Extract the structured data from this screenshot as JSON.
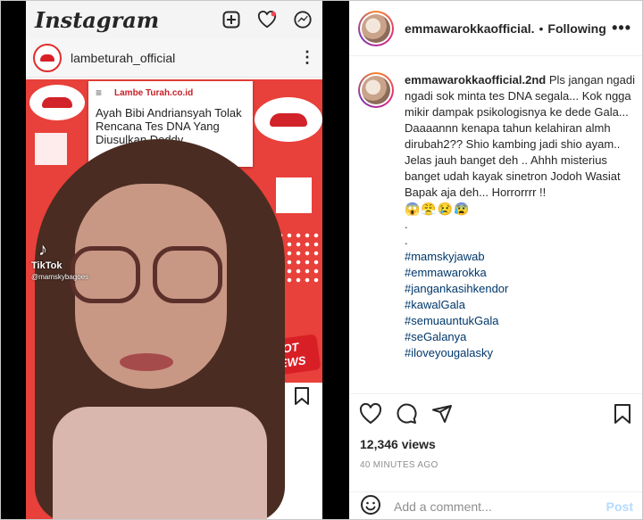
{
  "phone": {
    "app_logo": "Instagram",
    "account_name": "lambeturah_official",
    "card_site": "Lambe Turah.co.id",
    "card_headline": "Ayah Bibi Andriansyah Tolak Rencana Tes DNA Yang Diusulkan Doddy",
    "hot_news": "HOT NEWS",
    "tiktok_label": "TikTok",
    "tiktok_user": "@mamskybagoes"
  },
  "post_header": {
    "username": "emmawarokkaofficial.",
    "separator": "•",
    "follow_state": "Following",
    "more": "•••"
  },
  "caption": {
    "username": "emmawarokkaofficial.2nd",
    "text": "Pls jangan ngadi ngadi sok minta tes DNA segala... Kok ngga mikir dampak psikologisnya ke dede Gala... Daaaannn kenapa tahun kelahiran almh dirubah2?? Shio kambing jadi shio ayam.. Jelas jauh banget deh .. Ahhh misterius banget udah kayak sinetron Jodoh Wasiat Bapak aja deh... Horrorrrr !!",
    "emojis": "😱😤😢😰",
    "dot1": ".",
    "dot2": ".",
    "hashtags": [
      "#mamskyjawab",
      "#emmawarokka",
      "#jangankasihkendor",
      "#kawalGala",
      "#semuauntukGala",
      "#seGalanya",
      "#iloveyougalasky"
    ]
  },
  "stats": {
    "views": "12,346 views",
    "time": "40 MINUTES AGO"
  },
  "comment_box": {
    "placeholder": "Add a comment...",
    "post_label": "Post"
  },
  "icons": [
    "new-post-icon",
    "heart-icon",
    "messenger-icon",
    "more-vertical-icon",
    "bookmark-icon",
    "comment-icon",
    "share-icon",
    "emoji-icon"
  ],
  "colors": {
    "accent": "#0095f6",
    "post_disabled": "#b3dbff",
    "hashtag": "#00376b",
    "poster_red": "#e8403a"
  }
}
